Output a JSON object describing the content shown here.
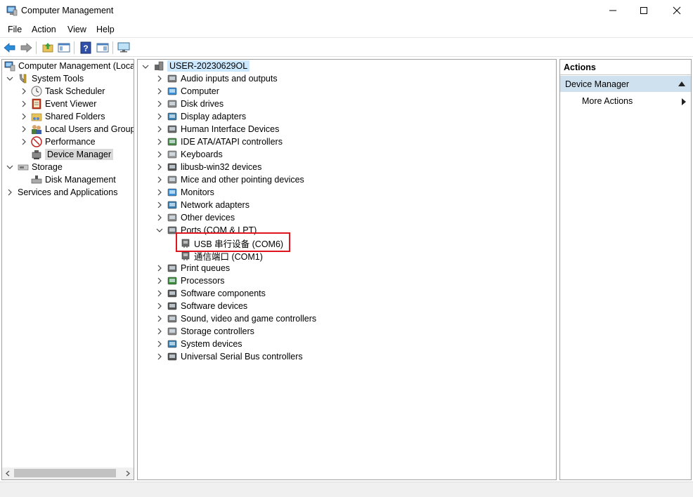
{
  "window": {
    "title": "Computer Management",
    "controls": [
      "minimize",
      "maximize",
      "close"
    ]
  },
  "menu": [
    "File",
    "Action",
    "View",
    "Help"
  ],
  "toolbar": {
    "buttons": [
      "back-icon",
      "forward-icon",
      "up-folder-icon",
      "show-hide-tree-icon",
      "help-icon",
      "properties-icon",
      "monitor-icon"
    ]
  },
  "left_tree": {
    "root": "Computer Management (Local",
    "system_tools": "System Tools",
    "task_scheduler": "Task Scheduler",
    "event_viewer": "Event Viewer",
    "shared_folders": "Shared Folders",
    "local_users": "Local Users and Groups",
    "performance": "Performance",
    "device_manager": "Device Manager",
    "storage": "Storage",
    "disk_management": "Disk Management",
    "services": "Services and Applications"
  },
  "device_tree": {
    "computer_name": "USER-20230629OL",
    "categories": [
      "Audio inputs and outputs",
      "Computer",
      "Disk drives",
      "Display adapters",
      "Human Interface Devices",
      "IDE ATA/ATAPI controllers",
      "Keyboards",
      "libusb-win32 devices",
      "Mice and other pointing devices",
      "Monitors",
      "Network adapters",
      "Other devices",
      "Ports (COM & LPT)"
    ],
    "ports_children": [
      "USB 串行设备 (COM6)",
      "通信端口 (COM1)"
    ],
    "categories_after": [
      "Print queues",
      "Processors",
      "Software components",
      "Software devices",
      "Sound, video and game controllers",
      "Storage controllers",
      "System devices",
      "Universal Serial Bus controllers"
    ]
  },
  "actions": {
    "header": "Actions",
    "section": "Device Manager",
    "more": "More Actions"
  },
  "colors": {
    "highlight": "#e0141e",
    "section_bg": "#cfe0ee",
    "selection_bg": "#cce8ff"
  }
}
